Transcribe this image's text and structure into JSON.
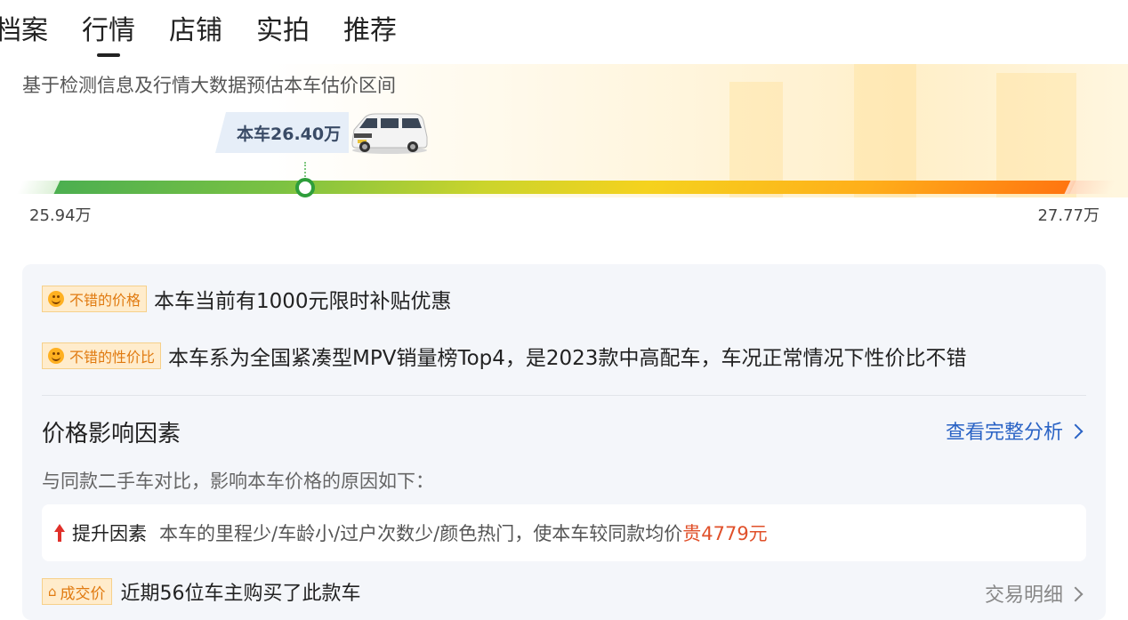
{
  "tabs": [
    {
      "label": "档案",
      "active": false
    },
    {
      "label": "行情",
      "active": true
    },
    {
      "label": "店铺",
      "active": false
    },
    {
      "label": "实拍",
      "active": false
    },
    {
      "label": "推荐",
      "active": false
    }
  ],
  "estimate": {
    "subtitle": "基于检测信息及行情大数据预估本车估价区间",
    "current_label": "本车26.40万",
    "current_value": 26.4,
    "min_label": "25.94万",
    "max_label": "27.77万",
    "min_value": 25.94,
    "max_value": 27.77
  },
  "highlights": [
    {
      "tag": "不错的价格",
      "text": "本车当前有1000元限时补贴优惠"
    },
    {
      "tag": "不错的性价比",
      "text": "本车系为全国紧凑型MPV销量榜Top4，是2023款中高配车，车况正常情况下性价比不错"
    }
  ],
  "factors": {
    "title": "价格影响因素",
    "link_label": "查看完整分析",
    "description": "与同款二手车对比，影响本车价格的原因如下：",
    "up": {
      "label": "提升因素",
      "text": "本车的里程少/车龄小/过户次数少/颜色热门，使本车较同款均价",
      "amount": "贵4779元"
    }
  },
  "deals": {
    "tag": "成交价",
    "tag_icon": "⌂",
    "text": "近期56位车主购买了此款车",
    "link_label": "交易明细"
  },
  "colors": {
    "bar_start": "#4caf50",
    "bar_end": "#ff7410",
    "marker": "#2e9e3b",
    "link": "#2a63c5",
    "increase": "#e0302a",
    "tag_bg": "#ffeccc",
    "tag_text": "#e07a10"
  }
}
